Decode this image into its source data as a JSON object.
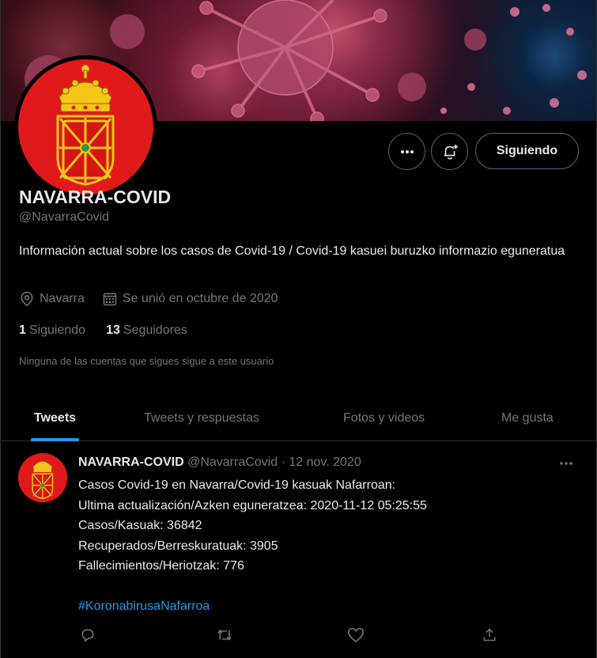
{
  "profile": {
    "name": "NAVARRA-COVID",
    "handle": "@NavarraCovid",
    "bio": "Información actual sobre los casos de Covid-19 / Covid-19 kasuei buruzko informazio eguneratua",
    "location": "Navarra",
    "joined": "Se unió en octubre de 2020",
    "following_count": "1",
    "following_label": "Siguiendo",
    "followers_count": "13",
    "followers_label": "Seguidores",
    "followers_note": "Ninguna de las cuentas que sigues sigue a este usuario",
    "follow_button": "Siguiendo"
  },
  "tabs": [
    {
      "label": "Tweets",
      "active": true
    },
    {
      "label": "Tweets y respuestas",
      "active": false
    },
    {
      "label": "Fotos y videos",
      "active": false
    },
    {
      "label": "Me gusta",
      "active": false
    }
  ],
  "tweet": {
    "name": "NAVARRA-COVID",
    "handle": "@NavarraCovid",
    "separator": "·",
    "date": "12 nov. 2020",
    "lines": [
      "Casos Covid-19 en Navarra/Covid-19 kasuak Nafarroan:",
      "Ultima actualización/Azken eguneratzea: 2020-11-12 05:25:55",
      "Casos/Kasuak: 36842",
      "Recuperados/Berreskuratuak: 3905",
      "Fallecimientos/Heriotzak: 776"
    ],
    "hashtag": "#KoronabirusaNafarroa"
  },
  "icons": {
    "more": "more-icon",
    "bell": "bell-plus-icon",
    "location": "location-pin-icon",
    "calendar": "calendar-icon",
    "reply": "reply-icon",
    "retweet": "retweet-icon",
    "like": "heart-icon",
    "share": "share-icon"
  },
  "colors": {
    "background": "#000000",
    "text": "#e7e9ea",
    "secondary": "#71767b",
    "accent": "#1d9bf0",
    "border": "#2f3336",
    "avatar": "#e01a1a"
  }
}
